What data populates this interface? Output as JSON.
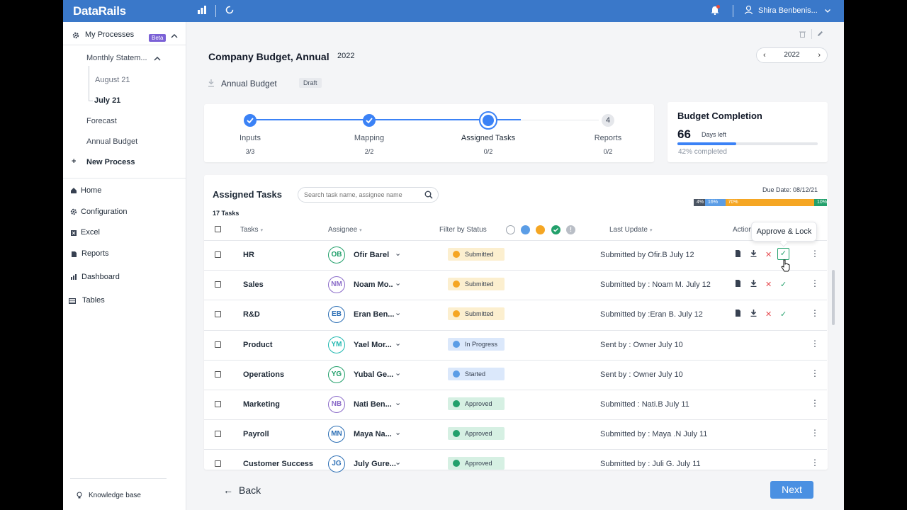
{
  "app": {
    "logo": "DataRails",
    "user_name": "Shira Benbenis..."
  },
  "sidebar": {
    "my_processes": "My Processes",
    "beta": "Beta",
    "monthly": "Monthly Statem...",
    "aug": "August 21",
    "jul": "July 21",
    "forecast": "Forecast",
    "annual": "Annual Budget",
    "new_process": "New Process",
    "home": "Home",
    "configuration": "Configuration",
    "excel": "Excel",
    "reports": "Reports",
    "dashboard": "Dashboard",
    "tables": "Tables",
    "knowledge": "Knowledge base"
  },
  "header": {
    "title": "Company Budget,  Annual",
    "year": "2022",
    "picker_year": "2022",
    "subtitle": "Annual Budget",
    "draft": "Draft"
  },
  "steps": [
    {
      "label": "Inputs",
      "count": "3/3"
    },
    {
      "label": "Mapping",
      "count": "2/2"
    },
    {
      "label": "Assigned Tasks",
      "count": "0/2"
    },
    {
      "label": "Reports",
      "count": "0/2",
      "number": "4"
    }
  ],
  "budget_completion": {
    "title": "Budget Completion",
    "days": "66",
    "days_label": "Days left",
    "pct_label": "42% completed",
    "progress": 0.42
  },
  "assigned": {
    "title": "Assigned Tasks",
    "search_placeholder": "Search task name, assignee name",
    "count": "17 Tasks",
    "due": "Due Date: 08/12/21",
    "segments": [
      {
        "label": "4%",
        "value": 4,
        "color": "#4b5563"
      },
      {
        "label": "16%",
        "value": 16,
        "color": "#5b9de6"
      },
      {
        "label": "70%",
        "value": 70,
        "color": "#f5a623"
      },
      {
        "label": "10%",
        "value": 10,
        "color": "#22a06b"
      }
    ],
    "columns": {
      "tasks": "Tasks",
      "assignee": "Assignee",
      "filter": "Filter by Status",
      "last_update": "Last Update",
      "actions": "Actions"
    }
  },
  "tooltip": "Approve & Lock",
  "rows": [
    {
      "task": "HR",
      "initials": "OB",
      "name": "Ofir Barel",
      "color": "#22a06b",
      "status": "Submitted",
      "skind": "sub",
      "update": "Submitted by Ofir.B   July 12",
      "actions": true
    },
    {
      "task": "Sales",
      "initials": "NM",
      "name": "Noam Mo..",
      "color": "#8b6cc9",
      "status": "Submitted",
      "skind": "sub",
      "update": "Submitted by : Noam M.   July 12",
      "actions": true
    },
    {
      "task": "R&D",
      "initials": "EB",
      "name": "Eran Ben...",
      "color": "#2c6fb5",
      "status": "Submitted",
      "skind": "sub",
      "update": "Submitted by :Eran B.   July 12",
      "actions": true
    },
    {
      "task": "Product",
      "initials": "YM",
      "name": "Yael Mor...",
      "color": "#20b8b0",
      "status": "In Progress",
      "skind": "prog",
      "update": "Sent by : Owner   July 10",
      "actions": false
    },
    {
      "task": "Operations",
      "initials": "YG",
      "name": "Yubal Ge...",
      "color": "#22a06b",
      "status": "Started",
      "skind": "prog",
      "update": "Sent by : Owner   July 10",
      "actions": false
    },
    {
      "task": "Marketing",
      "initials": "NB",
      "name": "Nati Ben...",
      "color": "#8b6cc9",
      "status": "Approved",
      "skind": "ok",
      "update": "Submitted : Nati.B   July 11",
      "actions": false
    },
    {
      "task": "Payroll",
      "initials": "MN",
      "name": "Maya Na...",
      "color": "#2c6fb5",
      "status": "Approved",
      "skind": "ok",
      "update": "Submitted by : Maya .N   July 11",
      "actions": false
    },
    {
      "task": "Customer Success",
      "initials": "JG",
      "name": "July Gure...",
      "color": "#2c6fb5",
      "status": "Approved",
      "skind": "ok",
      "update": "Submitted by : Juli G.   July 11",
      "actions": false
    }
  ],
  "footer": {
    "back": "Back",
    "next": "Next"
  }
}
